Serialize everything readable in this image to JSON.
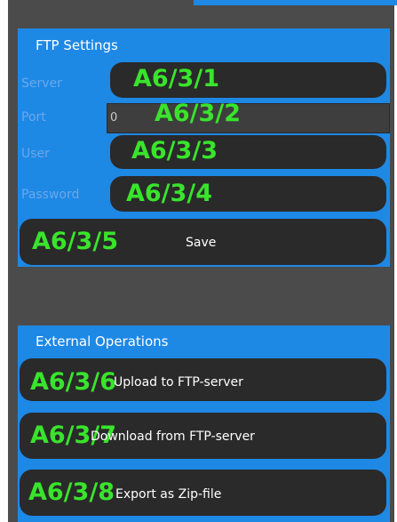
{
  "colors": {
    "background": "#4b4b4b",
    "panel": "#1e88e5",
    "field": "#2a2a2a",
    "label": "#6aa9e9",
    "tag": "#39e42c",
    "text": "#ffffff"
  },
  "ftp_settings": {
    "title": "FTP Settings",
    "server": {
      "label": "Server",
      "value": "",
      "tag": "A6/3/1"
    },
    "port": {
      "label": "Port",
      "value": "0",
      "tag": "A6/3/2"
    },
    "user": {
      "label": "User",
      "value": "",
      "tag": "A6/3/3"
    },
    "password": {
      "label": "Password",
      "value": "",
      "tag": "A6/3/4"
    },
    "save_button": {
      "label": "Save",
      "tag": "A6/3/5"
    }
  },
  "external_operations": {
    "title": "External Operations",
    "upload_button": {
      "label": "Upload to FTP-server",
      "tag": "A6/3/6"
    },
    "download_button": {
      "label": "Download from FTP-server",
      "tag": "A6/3/7"
    },
    "export_button": {
      "label": "Export as Zip-file",
      "tag": "A6/3/8"
    }
  }
}
